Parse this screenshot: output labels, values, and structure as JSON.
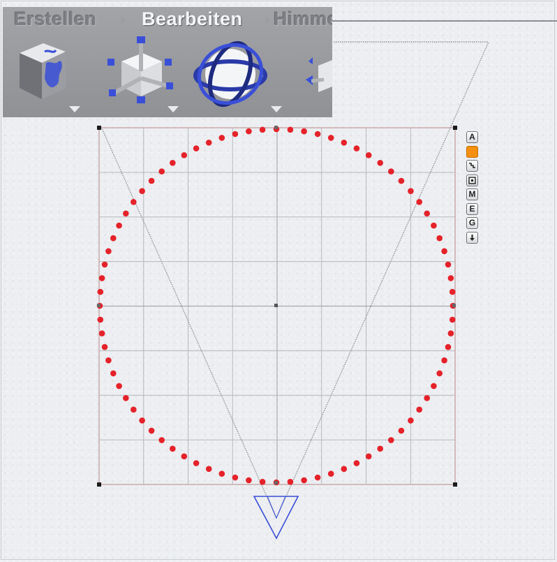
{
  "menu": {
    "tabs": [
      {
        "label": "Erstellen",
        "state": "inactive"
      },
      {
        "label": "Bearbeiten",
        "state": "active"
      },
      {
        "label": "Himmel",
        "state": "inactive-truncated"
      }
    ]
  },
  "tools": [
    {
      "icon": "textured-cube-icon",
      "has_dropdown": true
    },
    {
      "icon": "scale-gizmo-icon",
      "has_dropdown": true
    },
    {
      "icon": "rotate-gizmo-icon",
      "has_dropdown": true
    },
    {
      "icon": "move-gizmo-icon",
      "has_dropdown": false
    }
  ],
  "side_toolbar": [
    {
      "label": "A",
      "icon": "letter-a-icon"
    },
    {
      "label": "",
      "icon": "orange-color-swatch-icon"
    },
    {
      "label": "",
      "icon": "link-chain-icon"
    },
    {
      "label": "",
      "icon": "frame-selection-icon"
    },
    {
      "label": "M",
      "icon": "letter-m-icon"
    },
    {
      "label": "E",
      "icon": "letter-e-icon"
    },
    {
      "label": "G",
      "icon": "letter-g-icon"
    },
    {
      "label": "",
      "icon": "down-arrow-icon"
    }
  ],
  "colors": {
    "palette_bg": "#989a9e",
    "circle_points": "#e5222a",
    "bounding_box": "#c8a8aa",
    "grid": "#b6b8bc",
    "camera": "#3a4fd8",
    "swatch": "#f4900e"
  }
}
